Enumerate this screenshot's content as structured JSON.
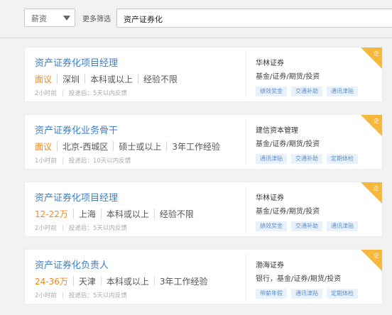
{
  "filters": {
    "salary_select": "薪资",
    "more_filters": "更多筛选",
    "search_value": "资产证券化"
  },
  "jobs": [
    {
      "title": "资产证券化项目经理",
      "salary": "面议",
      "city": "深圳",
      "education": "本科或以上",
      "experience": "经验不限",
      "posted": "2小时前",
      "feedback": "投递后：5天以内反馈",
      "company": "华林证券",
      "industry": "基金/证券/期货/投资",
      "tags": [
        "绩效奖金",
        "交通补助",
        "通讯津贴"
      ],
      "badge": "企"
    },
    {
      "title": "资产证券化业务骨干",
      "salary": "面议",
      "city": "北京-西城区",
      "education": "硕士或以上",
      "experience": "3年工作经验",
      "posted": "1小时前",
      "feedback": "投递后：10天以内反馈",
      "company": "建信资本管理",
      "industry": "基金/证券/期货/投资",
      "tags": [
        "通讯津贴",
        "交通补助",
        "定期体检"
      ],
      "badge": "企"
    },
    {
      "title": "资产证券化项目经理",
      "salary": "12-22万",
      "city": "上海",
      "education": "本科或以上",
      "experience": "经验不限",
      "posted": "2小时前",
      "feedback": "投递后：5天以内反馈",
      "company": "华林证券",
      "industry": "基金/证券/期货/投资",
      "tags": [
        "绩效奖金",
        "交通补助",
        "通讯津贴"
      ],
      "badge": "企"
    },
    {
      "title": "资产证券化负责人",
      "salary": "24-36万",
      "city": "天津",
      "education": "本科或以上",
      "experience": "3年工作经验",
      "posted": "2小时前",
      "feedback": "投递后：5天以内反馈",
      "company": "渤海证券",
      "industry": "银行，基金/证券/期货/投资",
      "tags": [
        "带薪年假",
        "通讯津贴",
        "定期体检"
      ],
      "badge": "企"
    }
  ]
}
